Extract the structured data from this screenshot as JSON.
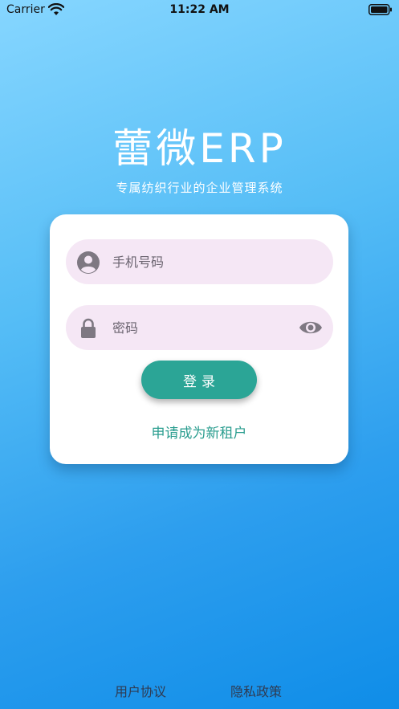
{
  "status_bar": {
    "carrier": "Carrier",
    "time": "11:22 AM"
  },
  "brand": {
    "title": "蕾微ERP",
    "subtitle": "专属纺织行业的企业管理系统"
  },
  "login_form": {
    "phone_placeholder": "手机号码",
    "password_placeholder": "密码",
    "login_label": "登录",
    "apply_label": "申请成为新租户"
  },
  "footer": {
    "agreement_label": "用户协议",
    "privacy_label": "隐私政策"
  },
  "icons": {
    "phone_field": "user-avatar-icon",
    "password_field": "lock-icon",
    "password_toggle": "eye-icon",
    "status_wifi": "wifi-icon",
    "status_battery": "battery-icon"
  },
  "colors": {
    "primary_button": "#2ba596",
    "link": "#2a9d8f",
    "field_background": "#f5e7f5",
    "gradient_top": "#86d6ff",
    "gradient_bottom": "#0f8de8"
  }
}
